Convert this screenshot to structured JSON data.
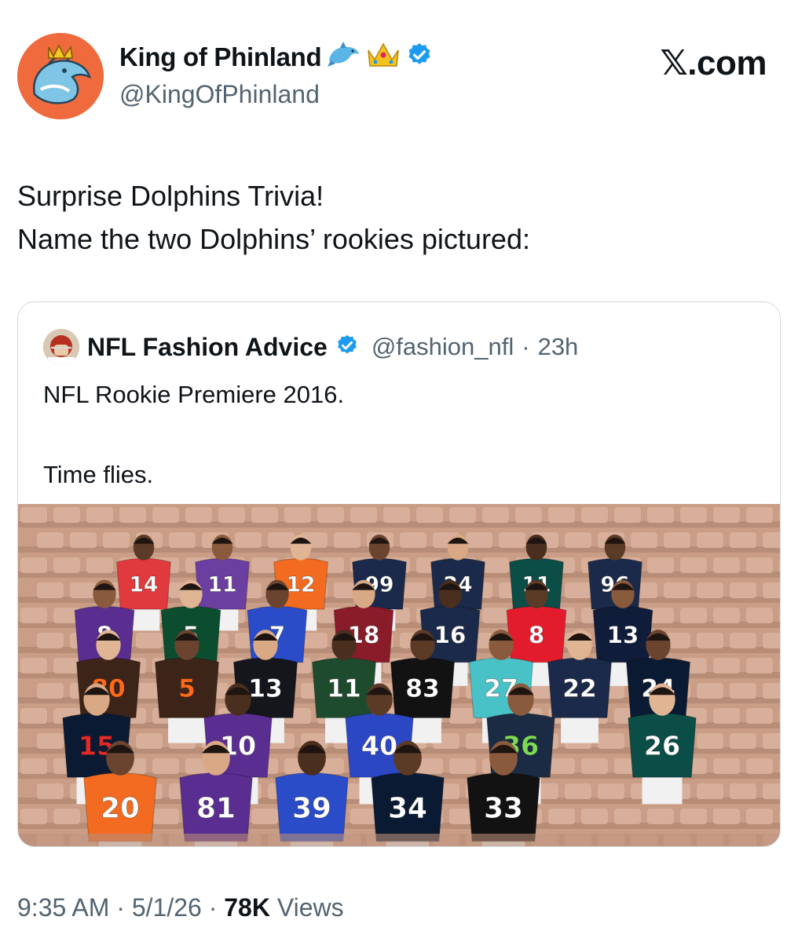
{
  "author": {
    "display_name": "King of Phinland",
    "handle": "@KingOfPhinland",
    "name_icons": [
      "dolphin-emoji-icon",
      "crown-emoji-icon",
      "verified-badge-icon"
    ]
  },
  "brand": {
    "label": ".com"
  },
  "tweet": {
    "line1": "Surprise Dolphins Trivia!",
    "line2": "Name the two Dolphins’ rookies pictured:"
  },
  "quoted": {
    "display_name": "NFL Fashion Advice",
    "handle": "@fashion_nfl",
    "separator": "·",
    "age": "23h",
    "line1": "NFL Rookie Premiere 2016.",
    "line2": "",
    "line3": "Time flies."
  },
  "photo": {
    "jerseys": [
      {
        "num": "14",
        "color": "#e03a3e",
        "text": "#ffffff"
      },
      {
        "num": "11",
        "color": "#6a3fa0",
        "text": "#ffffff"
      },
      {
        "num": "12",
        "color": "#f26b21",
        "text": "#ffffff"
      },
      {
        "num": "99",
        "color": "#1b2a4a",
        "text": "#ffffff"
      },
      {
        "num": "24",
        "color": "#1b2a4a",
        "text": "#ffffff"
      },
      {
        "num": "11",
        "color": "#0b4d47",
        "text": "#ffffff"
      },
      {
        "num": "96",
        "color": "#1b2a4a",
        "text": "#ffffff"
      },
      {
        "num": "8",
        "color": "#5a2d91",
        "text": "#ffffff"
      },
      {
        "num": "5",
        "color": "#0d4d2f",
        "text": "#ffffff"
      },
      {
        "num": "7",
        "color": "#2a4cc8",
        "text": "#ffffff"
      },
      {
        "num": "18",
        "color": "#8a1c2a",
        "text": "#ffffff"
      },
      {
        "num": "16",
        "color": "#1b2a4a",
        "text": "#ffffff"
      },
      {
        "num": "8",
        "color": "#e31c2d",
        "text": "#ffffff"
      },
      {
        "num": "13",
        "color": "#0f1c3a",
        "text": "#ffffff"
      },
      {
        "num": "80",
        "color": "#3d2418",
        "text": "#ff6a1a"
      },
      {
        "num": "5",
        "color": "#3d2418",
        "text": "#ff6a1a"
      },
      {
        "num": "13",
        "color": "#14161c",
        "text": "#ffffff"
      },
      {
        "num": "11",
        "color": "#1e4b2e",
        "text": "#ffffff"
      },
      {
        "num": "83",
        "color": "#121212",
        "text": "#ffffff"
      },
      {
        "num": "27",
        "color": "#48c2c6",
        "text": "#ffffff"
      },
      {
        "num": "22",
        "color": "#1b2a4a",
        "text": "#ffffff"
      },
      {
        "num": "24",
        "color": "#0b1a33",
        "text": "#ffffff"
      },
      {
        "num": "15",
        "color": "#0b1a33",
        "text": "#e22a2a"
      },
      {
        "num": "10",
        "color": "#5a2d91",
        "text": "#ffffff"
      },
      {
        "num": "40",
        "color": "#2c47c4",
        "text": "#ffffff"
      },
      {
        "num": "36",
        "color": "#1c2b44",
        "text": "#7ed957"
      },
      {
        "num": "26",
        "color": "#0b4d47",
        "text": "#ffffff"
      },
      {
        "num": "20",
        "color": "#f26b21",
        "text": "#ffffff"
      },
      {
        "num": "81",
        "color": "#5a2d91",
        "text": "#ffffff"
      },
      {
        "num": "39",
        "color": "#2a4cc8",
        "text": "#ffffff"
      },
      {
        "num": "34",
        "color": "#0b1a33",
        "text": "#ffffff"
      },
      {
        "num": "33",
        "color": "#121212",
        "text": "#ffffff"
      }
    ]
  },
  "meta": {
    "time": "9:35 AM",
    "sep1": "·",
    "date": "5/1/26",
    "sep2": "·",
    "views_count": "78K",
    "views_label": "Views"
  }
}
